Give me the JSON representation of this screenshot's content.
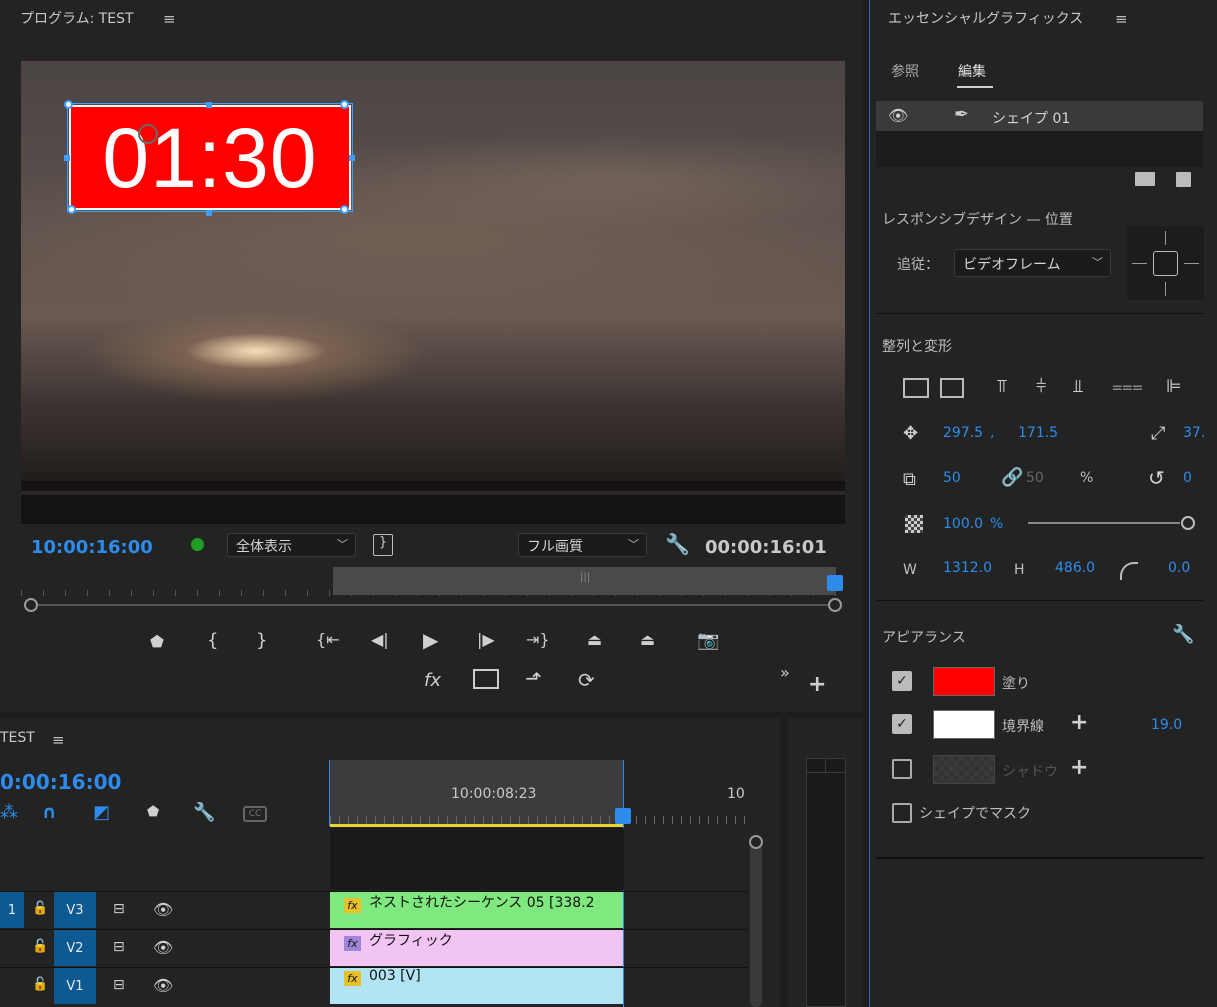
{
  "program_monitor": {
    "title": "プログラム: TEST",
    "menu_icon": "hamburger-menu-icon",
    "overlay_text": "01:30",
    "overlay_color": "#ff0000",
    "timecode_current": "10:00:16:00",
    "zoom_select": "全体表示",
    "quality_select": "フル画質",
    "timecode_duration": "00:00:16:01",
    "playhead_marker_color": "#2d8ceb",
    "status_color": "#1f9e23",
    "transport_buttons": [
      "add-marker",
      "mark-in",
      "mark-out",
      "go-to-in",
      "step-back",
      "play",
      "step-forward",
      "go-to-out",
      "lift",
      "extract",
      "export-frame"
    ],
    "secondary_buttons": [
      "fx",
      "safe-margins",
      "insert",
      "overwrite"
    ]
  },
  "timeline": {
    "sequence_title": "TEST",
    "timecode": "0:00:16:00",
    "ruler_time": "10:00:08:23",
    "ruler_end": "10",
    "tracks": [
      {
        "label": "V3",
        "target": "1",
        "clip": "ネストされたシーケンス 05 [338.2",
        "clip_color": "#7fe87f",
        "fx_color": "#e8c028"
      },
      {
        "label": "V2",
        "target": "",
        "clip": "グラフィック",
        "clip_color": "#f2c4f3",
        "fx_color": "#9c86d8"
      },
      {
        "label": "V1",
        "target": "",
        "clip": "003 [V]",
        "clip_color": "#b2e4f4",
        "fx_color": "#e8c028"
      }
    ]
  },
  "essential_graphics": {
    "title": "エッセンシャルグラフィックス",
    "tabs": {
      "browse": "参照",
      "edit": "編集"
    },
    "layer_name": "シェイプ 01",
    "responsive_title": "レスポンシブデザイン — 位置",
    "follow_label": "追従：",
    "follow_value": "ビデオフレーム",
    "align_title": "整列と変形",
    "position_x": "297.5",
    "position_comma": ",",
    "position_y": "171.5",
    "anchor_value": "37.",
    "scale": "50",
    "scale_linked": "50",
    "percent": "%",
    "rotation": "0",
    "opacity": "100.0",
    "opacity_unit": "%",
    "opacity_level": 1.0,
    "w_label": "W",
    "w_value": "1312.0",
    "h_label": "H",
    "h_value": "486.0",
    "corner_radius": "0.0",
    "appearance_title": "アピアランス",
    "fill_label": "塗り",
    "fill_color": "#ff0000",
    "stroke_label": "境界線",
    "stroke_color": "#ffffff",
    "stroke_width": "19.0",
    "shadow_label": "シャドウ",
    "mask_label": "シェイプでマスク"
  }
}
